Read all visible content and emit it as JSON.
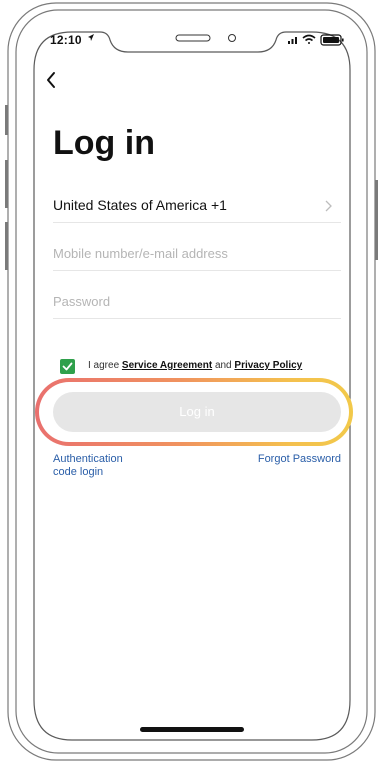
{
  "status_bar": {
    "time": "12:10"
  },
  "page": {
    "title": "Log in"
  },
  "country_row": {
    "label": "United States of America +1"
  },
  "account_input": {
    "placeholder": "Mobile number/e-mail address"
  },
  "password_input": {
    "placeholder": "Password"
  },
  "agreement": {
    "prefix": "I agree",
    "service_link": "Service Agreement",
    "connector": "and",
    "privacy_link": "Privacy Policy",
    "checked": true
  },
  "login_button": {
    "label": "Log in"
  },
  "links": {
    "auth_code_line1": "Authentication",
    "auth_code_line2": "code login",
    "forgot": "Forgot Password"
  },
  "colors": {
    "checkbox": "#2fa04b",
    "link": "#2a5ea8",
    "button_disabled": "#e6e6e6",
    "highlight_gradient_start": "#e9706e",
    "highlight_gradient_end": "#f2c94a"
  }
}
